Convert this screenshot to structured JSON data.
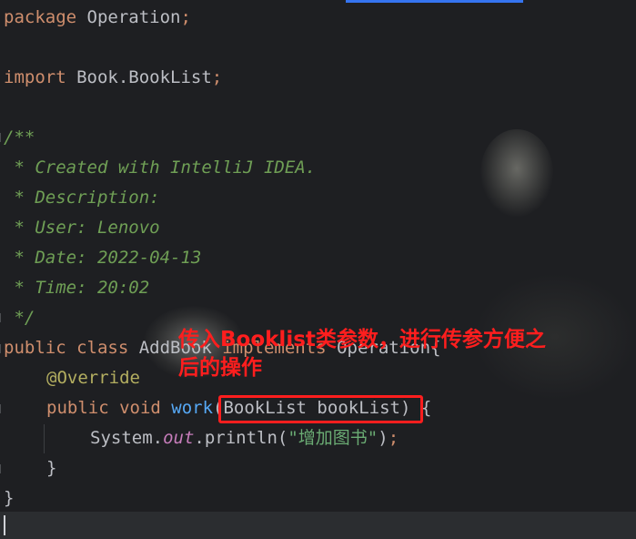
{
  "code": {
    "line1": {
      "kw": "package",
      "rest": " Operation",
      "semi": ";"
    },
    "line3": {
      "kw": "import",
      "rest": " Book.BookList",
      "semi": ";"
    },
    "doc": [
      "/**",
      " * Created with IntelliJ IDEA.",
      " * Description:",
      " * User: Lenovo",
      " * Date: 2022-04-13",
      " * Time: 20:02",
      " */"
    ],
    "class_line": {
      "kw1": "public",
      "kw2": " class",
      "name": " AddBook",
      "kw3": " implements",
      "iface": " Operation{"
    },
    "override": "@Override",
    "method_line": {
      "kw1": "public",
      "kw2": " void",
      "fn": " work",
      "params": "(BookList bookList)",
      "brace": " {"
    },
    "println_line": {
      "obj": "System.",
      "field": "out",
      "call": ".println(",
      "str": "\"增加图书\"",
      "close": ")",
      "semi": ";"
    },
    "close_method": "}",
    "close_class": "}"
  },
  "annotation": {
    "text": "传入Booklist类参数，进行传参方便之后的操作",
    "color": "#ff1e1e"
  },
  "colors": {
    "background": "#1e1f22",
    "keyword": "#cf8e6d",
    "comment": "#6f9f55",
    "annotation": "#b3ae60",
    "method": "#56a8f5",
    "string": "#6aab73"
  }
}
